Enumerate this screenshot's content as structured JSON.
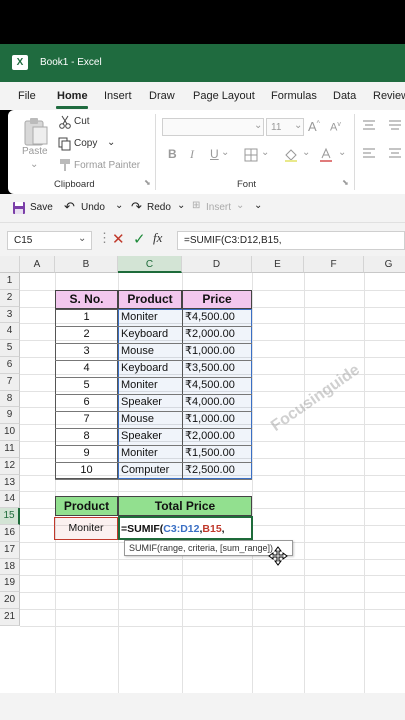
{
  "app": {
    "title": "Book1 - Excel",
    "logo_letter": "X"
  },
  "menu": [
    "File",
    "Home",
    "Insert",
    "Draw",
    "Page Layout",
    "Formulas",
    "Data",
    "Review"
  ],
  "ribbon": {
    "paste": "Paste",
    "cut": "Cut",
    "copy": "Copy",
    "format_painter": "Format Painter",
    "clipboard_group": "Clipboard",
    "font_size": "11",
    "font_group": "Font",
    "bold": "B",
    "italic": "I",
    "underline": "U"
  },
  "qat": {
    "save": "Save",
    "undo": "Undo",
    "redo": "Redo",
    "insert": "Insert"
  },
  "formula_bar": {
    "name_box": "C15",
    "fx": "fx",
    "formula": "=SUMIF(C3:D12,B15,"
  },
  "sheet": {
    "columns": [
      "A",
      "B",
      "C",
      "D",
      "E",
      "F",
      "G"
    ],
    "rows": [
      "1",
      "2",
      "3",
      "4",
      "5",
      "6",
      "7",
      "8",
      "9",
      "10",
      "11",
      "12",
      "13",
      "14",
      "15",
      "16",
      "17",
      "18",
      "19",
      "20",
      "21"
    ],
    "table_headers": [
      "S. No.",
      "Product",
      "Price"
    ],
    "table": [
      [
        "1",
        "Moniter",
        "₹4,500.00"
      ],
      [
        "2",
        "Keyboard",
        "₹2,000.00"
      ],
      [
        "3",
        "Mouse",
        "₹1,000.00"
      ],
      [
        "4",
        "Keyboard",
        "₹3,500.00"
      ],
      [
        "5",
        "Moniter",
        "₹4,500.00"
      ],
      [
        "6",
        "Speaker",
        "₹4,000.00"
      ],
      [
        "7",
        "Mouse",
        "₹1,000.00"
      ],
      [
        "8",
        "Speaker",
        "₹2,000.00"
      ],
      [
        "9",
        "Moniter",
        "₹1,500.00"
      ],
      [
        "10",
        "Computer",
        "₹2,500.00"
      ]
    ],
    "summary_headers": [
      "Product",
      "Total Price"
    ],
    "summary_product": "Moniter",
    "formula_prefix": "=SUMIF(",
    "formula_range": "C3:D12",
    "formula_sep": ",",
    "formula_crit": "B15",
    "formula_end": ",",
    "tooltip": "SUMIF(range, criteria, [sum_range])",
    "watermark": "Focusinguide"
  },
  "colors": {
    "excel_green": "#1f6b3f",
    "header_pink": "#f2c7ee",
    "header_green": "#92e08f",
    "range_blue": "#3a6fc4",
    "crit_red": "#c0392b"
  }
}
